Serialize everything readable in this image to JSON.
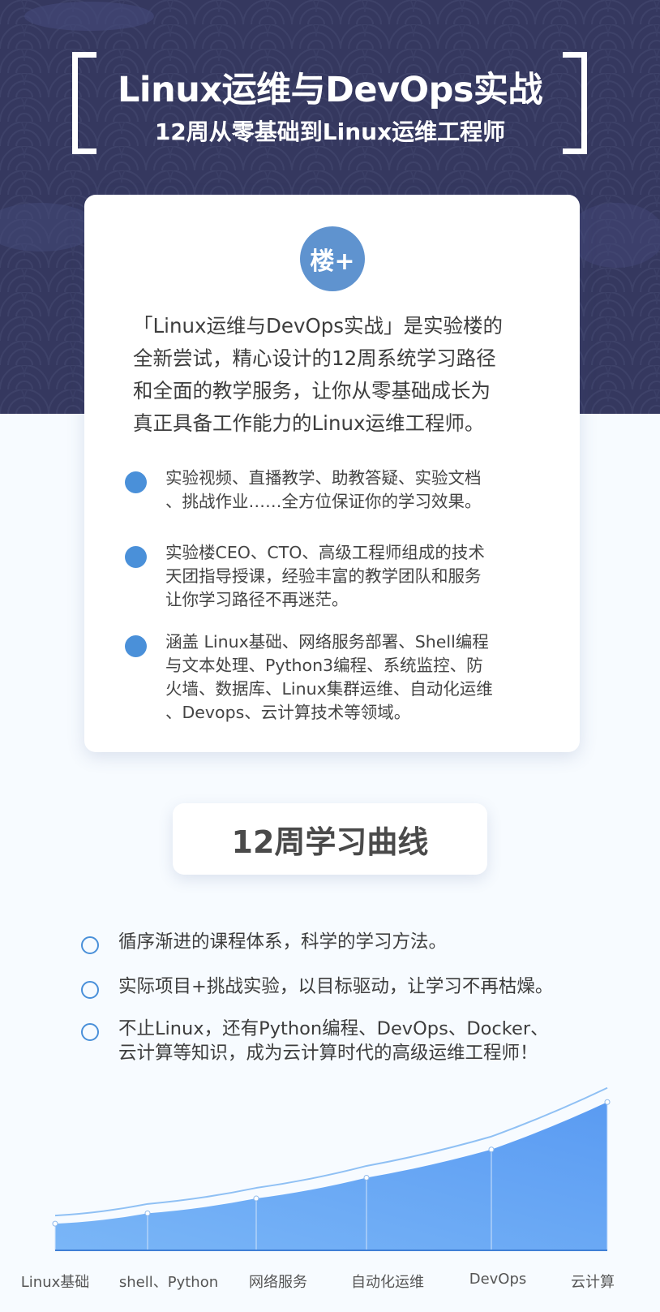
{
  "header": {
    "title": "Linux运维与DevOps实战",
    "subtitle": "12周从零基础到Linux运维工程师"
  },
  "intro_card": {
    "logo_text": "楼+",
    "intro_lines": [
      "「Linux运维与DevOps实战」是实验楼的",
      "全新尝试，精心设计的12周系统学习路径",
      "和全面的教学服务，让你从零基础成长为",
      "真正具备工作能力的Linux运维工程师。"
    ],
    "bullets": [
      {
        "lines": [
          "实验视频、直播教学、助教答疑、实验文档",
          "、挑战作业……全方位保证你的学习效果。"
        ]
      },
      {
        "lines": [
          "实验楼CEO、CTO、高级工程师组成的技术",
          "天团指导授课，经验丰富的教学团队和服务",
          "让你学习路径不再迷茫。"
        ]
      },
      {
        "lines": [
          "涵盖 Linux基础、网络服务部署、Shell编程",
          "与文本处理、Python3编程、系统监控、防",
          "火墙、数据库、Linux集群运维、自动化运维",
          "、Devops、云计算技术等领域。"
        ]
      }
    ]
  },
  "curve_section": {
    "title": "12周学习曲线",
    "points": [
      {
        "lines": [
          "循序渐进的课程体系，科学的学习方法。"
        ]
      },
      {
        "lines": [
          "实际项目+挑战实验，以目标驱动，让学习不再枯燥。"
        ]
      },
      {
        "lines": [
          "不止Linux，还有Python编程、DevOps、Docker、",
          "云计算等知识，成为云计算时代的高级运维工程师！"
        ]
      }
    ]
  },
  "chart_data": {
    "type": "area",
    "categories": [
      "Linux基础",
      "shell、Python",
      "网络服务",
      "自动化运维",
      "DevOps",
      "云计算"
    ],
    "values": [
      0.18,
      0.25,
      0.35,
      0.49,
      0.68,
      1.0
    ],
    "ylim": [
      0,
      1.1
    ],
    "grid": false,
    "colors": {
      "fill_top": "#5a9bf2",
      "fill_bottom": "#7ab6f7",
      "line": "#8fc0f4"
    }
  },
  "colors": {
    "hero_bg": "#35385f",
    "accent": "#4a90d9",
    "logo_bg": "#5f93cf"
  }
}
